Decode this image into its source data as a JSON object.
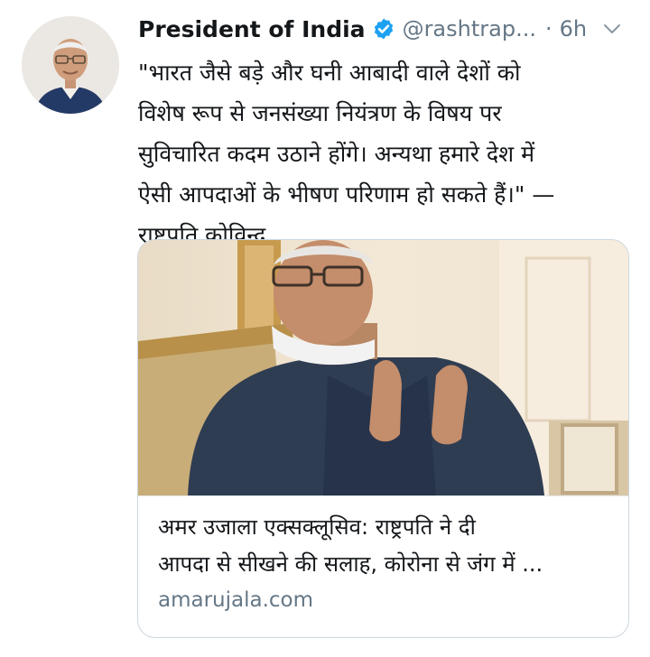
{
  "tweet": {
    "author_name": "President of India",
    "handle": "@rashtrap...",
    "separator": "·",
    "time": "6h",
    "text_lines": [
      "\"भारत जैसे बड़े और घनी आबादी वाले देशों को",
      "विशेष रूप से जनसंख्या नियंत्रण के विषय पर",
      "सुविचारित कदम उठाने होंगे। अन्यथा हमारे देश में",
      "ऐसी आपदाओं के भीषण परिणाम हो सकते हैं।\" —",
      "राष्ट्रपति कोविन्द"
    ]
  },
  "card": {
    "title_lines": [
      "अमर उजाला एक्सक्लूसिव: राष्ट्रपति ने दी",
      "आपदा से सीखने की सलाह, कोरोना से जंग में ..."
    ],
    "domain": "amarujala.com"
  },
  "colors": {
    "verified_blue": "#1da1f2",
    "secondary_text": "#657786",
    "card_border": "#ccd6dd"
  },
  "icons": {
    "verified": "verified-badge-icon",
    "caret": "chevron-down-icon"
  }
}
